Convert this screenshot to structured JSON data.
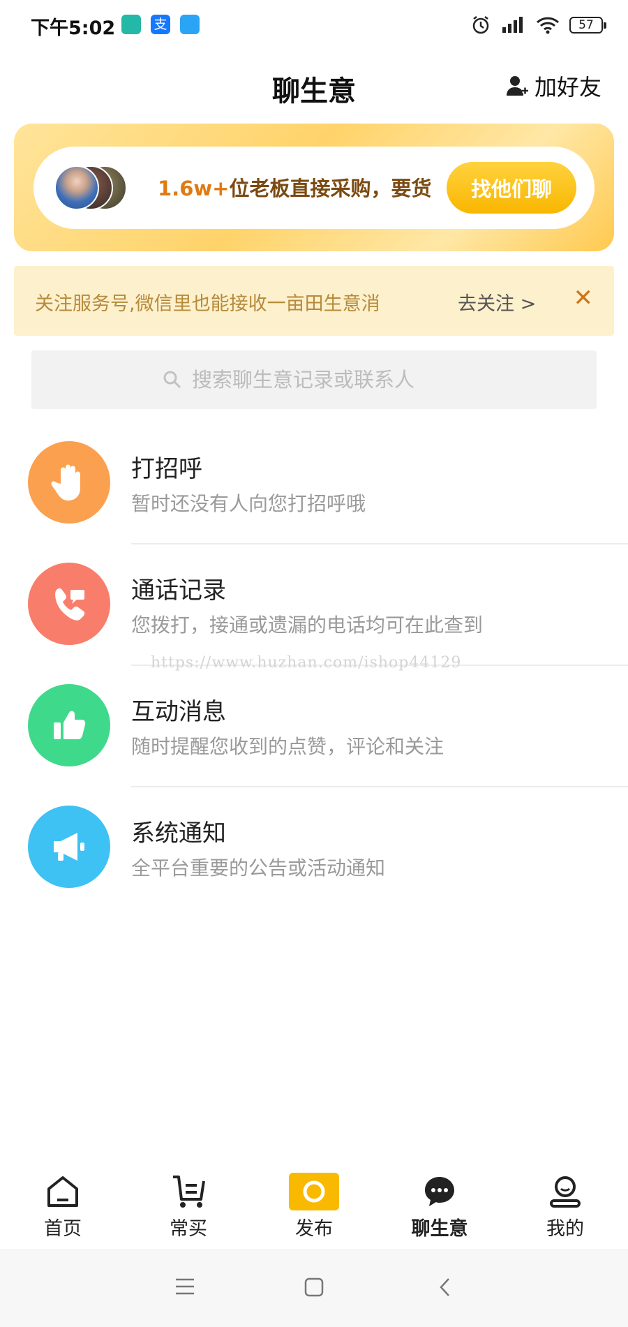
{
  "status_bar": {
    "time": "下午5:02",
    "battery": "57",
    "icons": [
      "boss-app-icon",
      "alipay-icon",
      "message-app-icon",
      "alarm-icon",
      "signal-icon",
      "wifi-icon",
      "battery-icon"
    ]
  },
  "header": {
    "title": "聊生意",
    "add_friend": "加好友"
  },
  "banner": {
    "count": "1.6w+",
    "text": "位老板直接采购，要货",
    "button": "找他们聊"
  },
  "notice": {
    "text": "关注服务号,微信里也能接收一亩田生意消",
    "follow": "去关注 >",
    "close": "✕"
  },
  "search": {
    "placeholder": "搜索聊生意记录或联系人"
  },
  "items": [
    {
      "title": "打招呼",
      "subtitle": "暂时还没有人向您打招呼哦",
      "color": "#fba04f",
      "icon": "hand-wave-icon"
    },
    {
      "title": "通话记录",
      "subtitle": "您拨打，接通或遗漏的电话均可在此查到",
      "color": "#f97d6b",
      "icon": "phone-icon"
    },
    {
      "title": "互动消息",
      "subtitle": "随时提醒您收到的点赞，评论和关注",
      "color": "#3fd98b",
      "icon": "thumbs-up-icon"
    },
    {
      "title": "系统通知",
      "subtitle": "全平台重要的公告或活动通知",
      "color": "#3ec1f3",
      "icon": "megaphone-icon"
    }
  ],
  "watermark": "https://www.huzhan.com/ishop44129",
  "bottom_nav": [
    {
      "label": "首页",
      "icon": "home-icon"
    },
    {
      "label": "常买",
      "icon": "cart-icon"
    },
    {
      "label": "发布",
      "icon": "publish-icon"
    },
    {
      "label": "聊生意",
      "icon": "chat-icon"
    },
    {
      "label": "我的",
      "icon": "profile-icon"
    }
  ],
  "colors": {
    "accent": "#f9b900",
    "banner_text": "#7a4a12",
    "notice_bg": "#fdf0cc"
  }
}
